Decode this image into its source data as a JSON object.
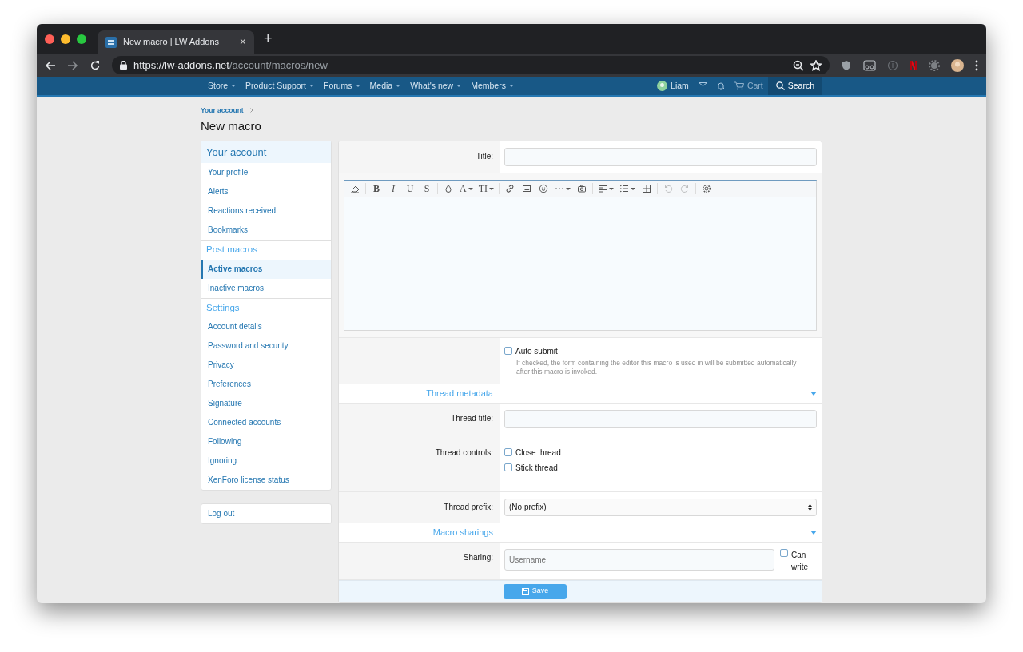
{
  "browser": {
    "tab_title": "New macro | LW Addons",
    "tab_close": "×",
    "new_tab": "+",
    "url_host": "https://lw-addons.net",
    "url_path": "/account/macros/new"
  },
  "navbar": {
    "items": [
      {
        "label": "Store"
      },
      {
        "label": "Product Support"
      },
      {
        "label": "Forums"
      },
      {
        "label": "Media"
      },
      {
        "label": "What's new"
      },
      {
        "label": "Members"
      }
    ],
    "user": "Liam",
    "cart": "Cart",
    "search": "Search"
  },
  "breadcrumb": "Your account",
  "page_title": "New macro",
  "sidebar": {
    "title": "Your account",
    "sections": [
      {
        "items": [
          {
            "label": "Your profile",
            "selected": false
          },
          {
            "label": "Alerts",
            "selected": false
          },
          {
            "label": "Reactions received",
            "selected": false
          },
          {
            "label": "Bookmarks",
            "selected": false
          }
        ]
      },
      {
        "heading": "Post macros",
        "items": [
          {
            "label": "Active macros",
            "selected": true
          },
          {
            "label": "Inactive macros",
            "selected": false
          }
        ]
      },
      {
        "heading": "Settings",
        "items": [
          {
            "label": "Account details",
            "selected": false
          },
          {
            "label": "Password and security",
            "selected": false
          },
          {
            "label": "Privacy",
            "selected": false
          },
          {
            "label": "Preferences",
            "selected": false
          },
          {
            "label": "Signature",
            "selected": false
          },
          {
            "label": "Connected accounts",
            "selected": false
          },
          {
            "label": "Following",
            "selected": false
          },
          {
            "label": "Ignoring",
            "selected": false
          },
          {
            "label": "XenForo license status",
            "selected": false
          }
        ]
      }
    ],
    "logout": "Log out"
  },
  "form": {
    "title_label": "Title:",
    "toolbar": [
      {
        "kind": "eraser"
      },
      {
        "kind": "sep"
      },
      {
        "kind": "letter",
        "glyph": "B"
      },
      {
        "kind": "letter",
        "glyph": "I"
      },
      {
        "kind": "letter",
        "glyph": "U"
      },
      {
        "kind": "letter",
        "glyph": "S"
      },
      {
        "kind": "sep"
      },
      {
        "kind": "drop"
      },
      {
        "kind": "letter",
        "glyph": "A",
        "menu": true
      },
      {
        "kind": "letter",
        "glyph": "TI",
        "menu": true
      },
      {
        "kind": "sep"
      },
      {
        "kind": "link"
      },
      {
        "kind": "image"
      },
      {
        "kind": "smiley"
      },
      {
        "kind": "dots",
        "menu": true
      },
      {
        "kind": "camera"
      },
      {
        "kind": "sep"
      },
      {
        "kind": "align",
        "menu": true
      },
      {
        "kind": "list",
        "menu": true
      },
      {
        "kind": "table"
      },
      {
        "kind": "sep"
      },
      {
        "kind": "undo",
        "disabled": true
      },
      {
        "kind": "redo",
        "disabled": true
      },
      {
        "kind": "sep"
      },
      {
        "kind": "gear"
      }
    ],
    "auto_submit": {
      "label": "Auto submit",
      "checked": false,
      "hint": "If checked, the form containing the editor this macro is used in will be submitted automatically after this macro is invoked."
    },
    "sections": [
      {
        "heading": "Thread metadata",
        "expanded": true,
        "rows": [
          {
            "kind": "input",
            "label": "Thread title:"
          },
          {
            "kind": "checks",
            "label": "Thread controls:",
            "options": [
              {
                "label": "Close thread",
                "checked": false
              },
              {
                "label": "Stick thread",
                "checked": false
              }
            ]
          },
          {
            "kind": "select",
            "label": "Thread prefix:",
            "value": "(No prefix)"
          }
        ]
      },
      {
        "heading": "Macro sharings",
        "expanded": true,
        "rows": [
          {
            "kind": "sharing",
            "label": "Sharing:",
            "placeholder": "Username",
            "option": {
              "label": "Can write",
              "checked": false
            }
          }
        ]
      }
    ],
    "save": "Save"
  }
}
